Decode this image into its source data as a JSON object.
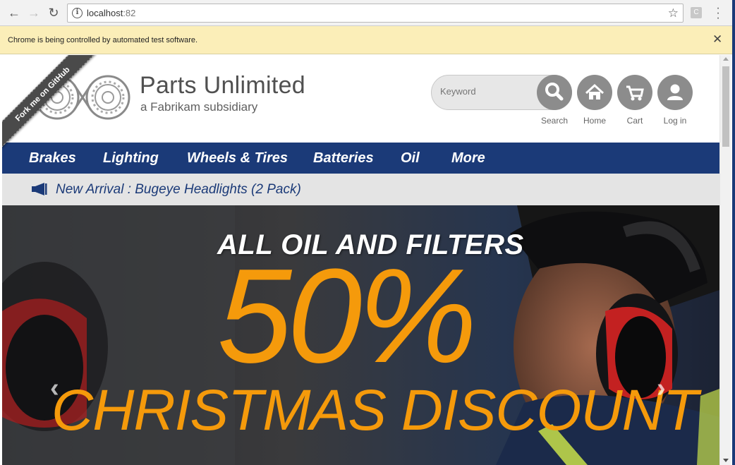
{
  "browser": {
    "url_host": "localhost",
    "url_port": ":82",
    "extension_label": "C",
    "infobar_message": "Chrome is being controlled by automated test software."
  },
  "header": {
    "ribbon": "Fork me on GitHub",
    "brand_name": "Parts Unlimited",
    "brand_sub": "a Fabrikam subsidiary",
    "search_placeholder": "Keyword",
    "buttons": [
      {
        "label": "Search",
        "icon": "search-icon"
      },
      {
        "label": "Home",
        "icon": "home-icon"
      },
      {
        "label": "Cart",
        "icon": "cart-icon"
      },
      {
        "label": "Log in",
        "icon": "user-icon"
      }
    ]
  },
  "nav": {
    "items": [
      "Brakes",
      "Lighting",
      "Wheels & Tires",
      "Batteries",
      "Oil",
      "More"
    ]
  },
  "announcement": {
    "text": "New Arrival : Bugeye Headlights (2 Pack)"
  },
  "hero": {
    "line1": "ALL OIL AND FILTERS",
    "line2": "50%",
    "line3": "CHRISTMAS DISCOUNT",
    "prev_glyph": "‹",
    "next_glyph": "›"
  },
  "colors": {
    "nav_bg": "#1b3a78",
    "accent_orange": "#f59a0b",
    "infobar_bg": "#fbeeb8"
  }
}
